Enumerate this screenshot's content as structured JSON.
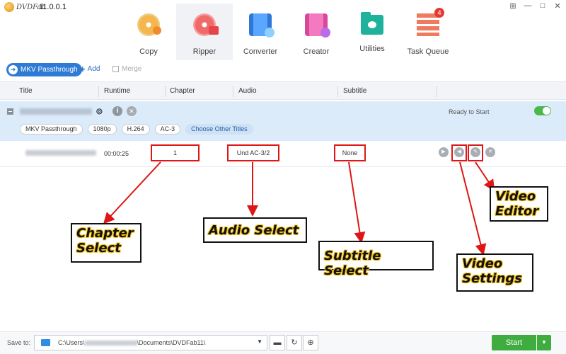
{
  "app": {
    "logo_text": "DVDFab",
    "version": "11.0.0.1"
  },
  "window_controls": {
    "pin": "⊞",
    "minimize": "—",
    "restore": "□",
    "close": "✕"
  },
  "modules": [
    {
      "label": "Copy",
      "icon": "copy-disc-icon",
      "active": false
    },
    {
      "label": "Ripper",
      "icon": "ripper-disc-icon",
      "active": true
    },
    {
      "label": "Converter",
      "icon": "converter-film-icon",
      "active": false
    },
    {
      "label": "Creator",
      "icon": "creator-film-icon",
      "active": false
    },
    {
      "label": "Utilities",
      "icon": "utilities-folder-icon",
      "active": false
    },
    {
      "label": "Task Queue",
      "icon": "task-queue-icon",
      "active": false,
      "badge": "4"
    }
  ],
  "toolbar": {
    "mode_label": "MKV Passthrough",
    "add_label": "Add",
    "merge_label": "Merge"
  },
  "columns": [
    "Title",
    "Runtime",
    "Chapter",
    "Audio",
    "Subtitle"
  ],
  "title_row": {
    "status": "Ready to Start",
    "toggle_on": true,
    "disc_badge": "BD",
    "chips": [
      "MKV Passthrough",
      "1080p",
      "H.264",
      "AC-3"
    ],
    "choose_titles": "Choose Other Titles"
  },
  "chapter_row": {
    "runtime": "00:00:25",
    "chapter": "1",
    "audio": "Und AC-3/2",
    "subtitle": "None"
  },
  "annotations": {
    "chapter": [
      "Chapter",
      "Select"
    ],
    "audio": "Audio Select",
    "subtitle": "Subtitle Select",
    "video_settings": [
      "Video",
      "Settings"
    ],
    "video_editor": [
      "Video",
      "Editor"
    ],
    "color": "#e01515"
  },
  "footer": {
    "save_to_label": "Save to:",
    "path_start": "C:\\Users\\",
    "path_end": "\\Documents\\DVDFab11\\",
    "start_label": "Start"
  },
  "colors": {
    "accent": "#2e7bd6",
    "start_green": "#3fac3f",
    "selected_row": "#dcebfa",
    "annotation_red": "#e01515"
  }
}
